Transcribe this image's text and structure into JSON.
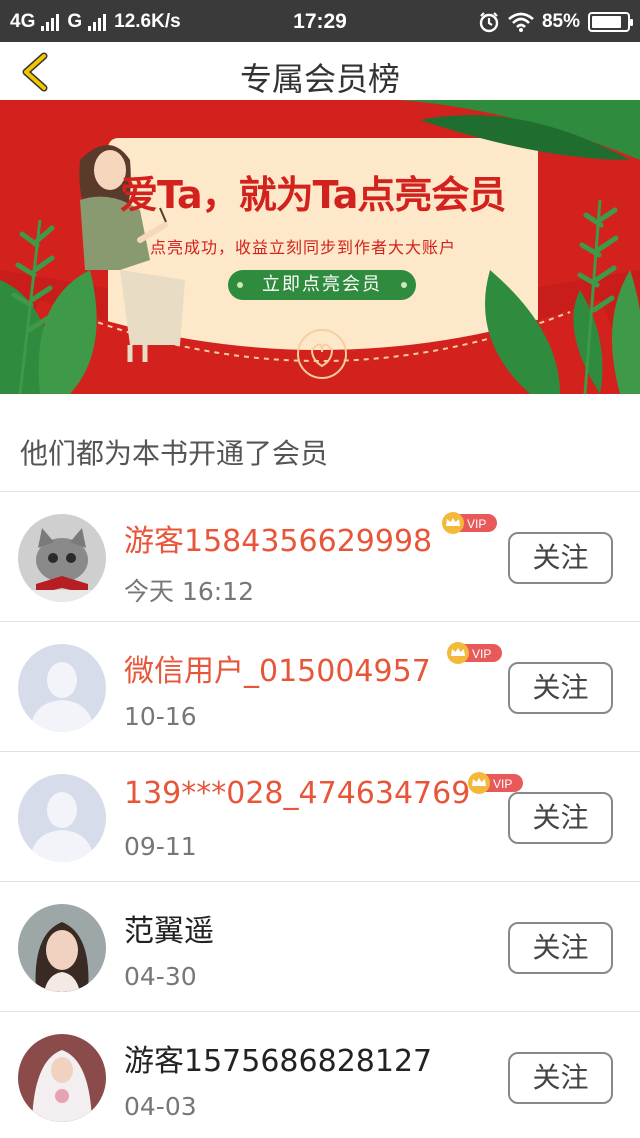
{
  "status_bar": {
    "network1": "4G",
    "network2": "G",
    "speed": "12.6K/s",
    "time": "17:29",
    "battery": "85%",
    "battery_level": 0.85,
    "icons": [
      "signal-icon",
      "alarm-icon",
      "wifi-icon",
      "battery-icon"
    ]
  },
  "nav": {
    "title": "专属会员榜",
    "back_icon": "chevron-left-icon"
  },
  "banner": {
    "headline": "爱Ta，就为Ta点亮会员",
    "subtitle": "点亮成功，收益立刻同步到作者大大账户",
    "cta": "立即点亮会员"
  },
  "section": {
    "title": "他们都为本书开通了会员"
  },
  "members": [
    {
      "name": "游客1584356629998",
      "time": "今天 16:12",
      "vip": true,
      "vip_label": "VIP",
      "follow": "关注",
      "avatar": "cat-avatar"
    },
    {
      "name": "微信用户_015004957",
      "time": "10-16",
      "vip": true,
      "vip_label": "VIP",
      "follow": "关注",
      "avatar": "default-avatar"
    },
    {
      "name": "139***028_474634769",
      "time": "09-11",
      "vip": true,
      "vip_label": "VIP",
      "follow": "关注",
      "avatar": "default-avatar"
    },
    {
      "name": "范翼遥",
      "time": "04-30",
      "vip": false,
      "follow": "关注",
      "avatar": "woman-photo-avatar"
    },
    {
      "name": "游客1575686828127",
      "time": "04-03",
      "vip": false,
      "follow": "关注",
      "avatar": "bride-photo-avatar"
    }
  ],
  "colors": {
    "vip_name": "#e8563a",
    "banner_red": "#d3211d",
    "cta_green": "#2f8b3e",
    "status_bar": "#3a3a3a",
    "back_chevron": "#e6b800"
  }
}
